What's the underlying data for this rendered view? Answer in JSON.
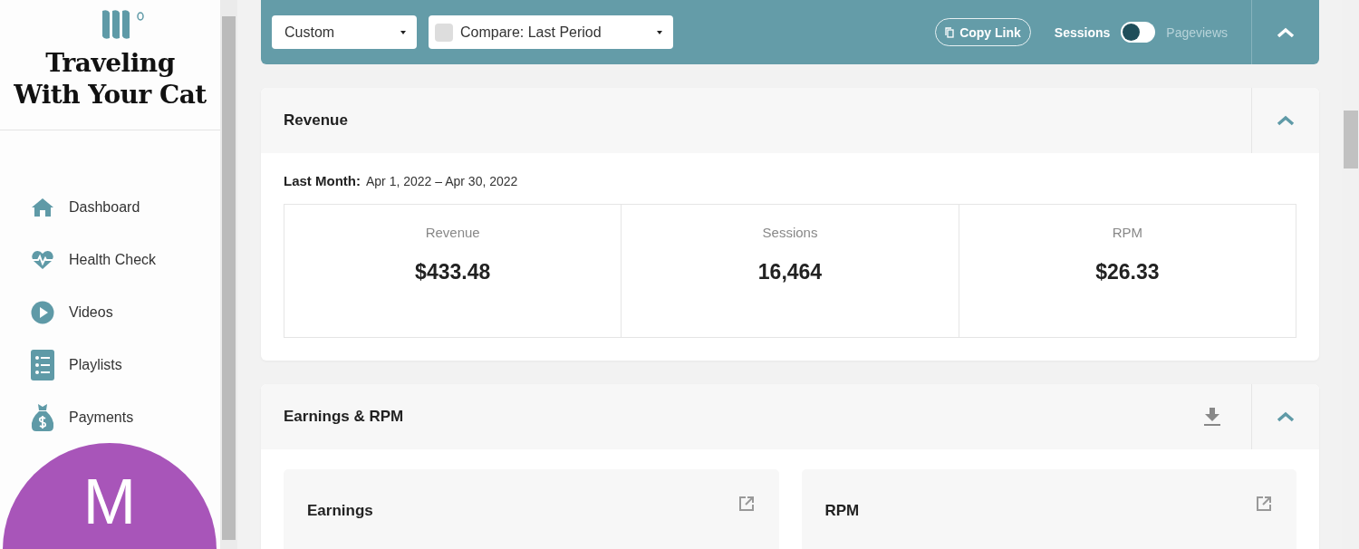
{
  "site": {
    "title": "Traveling With Your Cat"
  },
  "nav": [
    {
      "label": "Dashboard",
      "kind": "home"
    },
    {
      "label": "Health Check",
      "kind": "health"
    },
    {
      "label": "Videos",
      "kind": "video"
    },
    {
      "label": "Playlists",
      "kind": "list"
    },
    {
      "label": "Payments",
      "kind": "money"
    }
  ],
  "avatar": {
    "initial": "M",
    "color": "#a855b9"
  },
  "toolbar": {
    "period": "Custom",
    "compare": {
      "label": "Compare: Last Period",
      "checked": false
    },
    "copy_link": "Copy Link",
    "toggle": {
      "left": "Sessions",
      "right": "Pageviews",
      "on": false
    }
  },
  "revenue": {
    "title": "Revenue",
    "range_label": "Last Month:",
    "range": "Apr 1, 2022 – Apr 30, 2022",
    "expanded": true,
    "stats": [
      {
        "label": "Revenue",
        "value": "$433.48"
      },
      {
        "label": "Sessions",
        "value": "16,464"
      },
      {
        "label": "RPM",
        "value": "$26.33"
      }
    ]
  },
  "earnings": {
    "title": "Earnings & RPM",
    "expanded": true,
    "cards": [
      "Earnings",
      "RPM"
    ]
  }
}
